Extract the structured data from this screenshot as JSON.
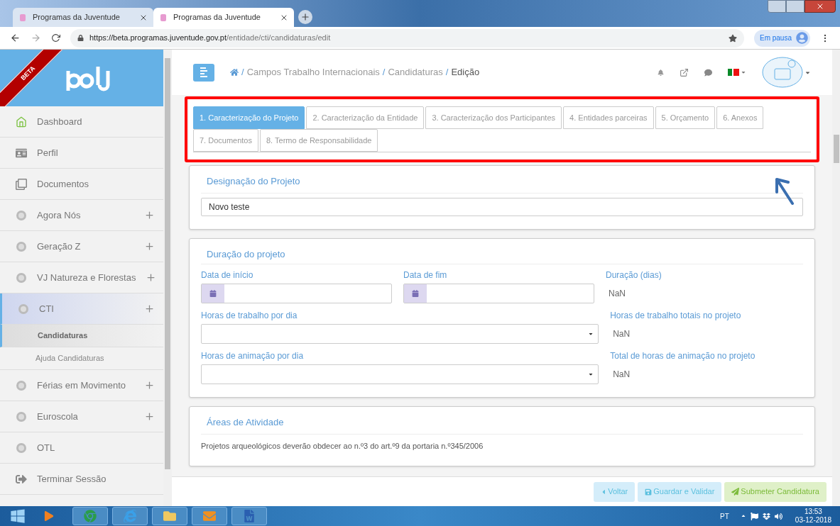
{
  "browser": {
    "tabs": [
      {
        "title": "Programas da Juventude",
        "selected": false
      },
      {
        "title": "Programas da Juventude",
        "selected": true
      }
    ],
    "url_host": "https://beta.programas.juventude.gov.pt",
    "url_path": "/entidade/cti/candidaturas/edit",
    "profile": "Em pausa"
  },
  "sidebar": {
    "ribbon": "BETA",
    "items": [
      {
        "label": "Dashboard",
        "kind": "home",
        "expandable": false,
        "selected": false
      },
      {
        "label": "Perfil",
        "kind": "card",
        "expandable": false,
        "selected": false
      },
      {
        "label": "Documentos",
        "kind": "docs",
        "expandable": false,
        "selected": false
      },
      {
        "label": "Agora Nós",
        "kind": "logo",
        "expandable": true,
        "selected": false
      },
      {
        "label": "Geração Z",
        "kind": "logo",
        "expandable": true,
        "selected": false
      },
      {
        "label": "VJ Natureza e Florestas",
        "kind": "logo",
        "expandable": true,
        "selected": false
      },
      {
        "label": "CTI",
        "kind": "logo",
        "expandable": true,
        "selected": true,
        "children": [
          {
            "label": "Candidaturas",
            "selected": true
          },
          {
            "label": "Ajuda Candidaturas",
            "selected": false
          }
        ]
      },
      {
        "label": "Férias em Movimento",
        "kind": "logo",
        "expandable": true,
        "selected": false
      },
      {
        "label": "Euroscola",
        "kind": "logo",
        "expandable": true,
        "selected": false
      },
      {
        "label": "OTL",
        "kind": "logo",
        "expandable": false,
        "selected": false
      },
      {
        "label": "Terminar Sessão",
        "kind": "exit",
        "expandable": false,
        "selected": false
      }
    ]
  },
  "breadcrumb": [
    "Campos Trabalho Internacionais",
    "Candidaturas",
    "Edição"
  ],
  "breadcrumb_separator": "/",
  "tabs": [
    {
      "label": "1. Caracterização do Projeto",
      "selected": true
    },
    {
      "label": "2. Caracterização da Entidade",
      "selected": false
    },
    {
      "label": "3. Caracterização dos Participantes",
      "selected": false
    },
    {
      "label": "4. Entidades parceiras",
      "selected": false
    },
    {
      "label": "5. Orçamento",
      "selected": false
    },
    {
      "label": "6. Anexos",
      "selected": false
    },
    {
      "label": "7. Documentos",
      "selected": false
    },
    {
      "label": "8. Termo de Responsabilidade",
      "selected": false
    }
  ],
  "designacao": {
    "title": "Designação do Projeto",
    "value": "Novo teste"
  },
  "duracao": {
    "title": "Duração do projeto",
    "rows": [
      [
        {
          "label": "Data de início",
          "kind": "date"
        },
        {
          "label": "Data de fim",
          "kind": "date"
        },
        {
          "label": "Duração (dias)",
          "kind": "readout",
          "value": "NaN"
        }
      ],
      [
        {
          "label": "Horas de trabalho por dia",
          "kind": "select"
        },
        {
          "label": "Horas de trabalho totais no projeto",
          "kind": "readout",
          "value": "NaN"
        }
      ],
      [
        {
          "label": "Horas de animação por dia",
          "kind": "select"
        },
        {
          "label": "Total de horas de animação no projeto",
          "kind": "readout",
          "value": "NaN"
        }
      ]
    ]
  },
  "areas": {
    "title": "Áreas de Atividade",
    "note": "Projetos arqueológicos deverão obdecer ao n.º3 do art.º9 da portaria n.º345/2006"
  },
  "actions": [
    {
      "label": "Voltar",
      "kind": "back"
    },
    {
      "label": "Guardar e Validar",
      "kind": "save"
    },
    {
      "label": "Submeter Candidatura",
      "kind": "submit"
    }
  ],
  "taskbar": {
    "language": "PT",
    "time": "13:53",
    "date": "03-12-2018"
  }
}
